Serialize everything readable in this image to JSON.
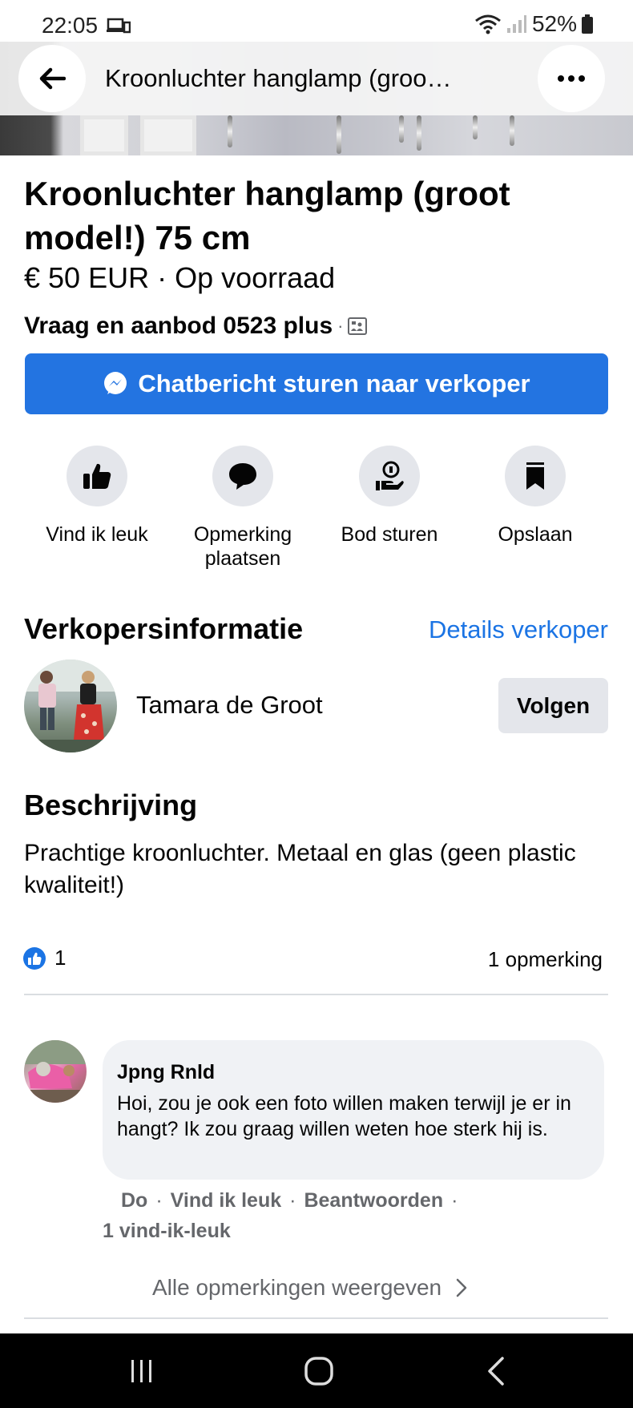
{
  "status": {
    "time": "22:05",
    "battery": "52%"
  },
  "header": {
    "title": "Kroonluchter hanglamp (groo…"
  },
  "listing": {
    "title": "Kroonluchter hanglamp (groot model!) 75 cm",
    "price_line": "€ 50 EUR · Op voorraad",
    "group": "Vraag en aanbod 0523 plus",
    "group_sep": "·",
    "chat_button": "Chatbericht sturen naar verkoper"
  },
  "actions": [
    {
      "label": "Vind ik leuk",
      "icon": "thumbs-up-icon"
    },
    {
      "label": "Opmerking plaatsen",
      "icon": "comment-icon"
    },
    {
      "label": "Bod sturen",
      "icon": "offer-icon"
    },
    {
      "label": "Opslaan",
      "icon": "bookmark-icon"
    }
  ],
  "seller": {
    "section_title": "Verkopersinformatie",
    "details_link": "Details verkoper",
    "name": "Tamara de Groot",
    "follow": "Volgen"
  },
  "description": {
    "section_title": "Beschrijving",
    "text": "Prachtige kroonluchter. Metaal en glas (geen plastic kwaliteit!)"
  },
  "engagement": {
    "likes": "1",
    "comments": "1 opmerking"
  },
  "comment": {
    "author": "Jpng Rnld",
    "text": "Hoi, zou je ook een foto willen maken terwijl je er in hangt? Ik zou graag willen weten hoe sterk hij is.",
    "time": "Do",
    "like": "Vind ik leuk",
    "reply": "Beantwoorden",
    "sep": "·",
    "likes": "1 vind-ik-leuk"
  },
  "all_comments": "Alle opmerkingen weergeven",
  "colors": {
    "accent": "#2374e1",
    "link": "#1b74e4",
    "button_gray": "#e4e6eb"
  }
}
